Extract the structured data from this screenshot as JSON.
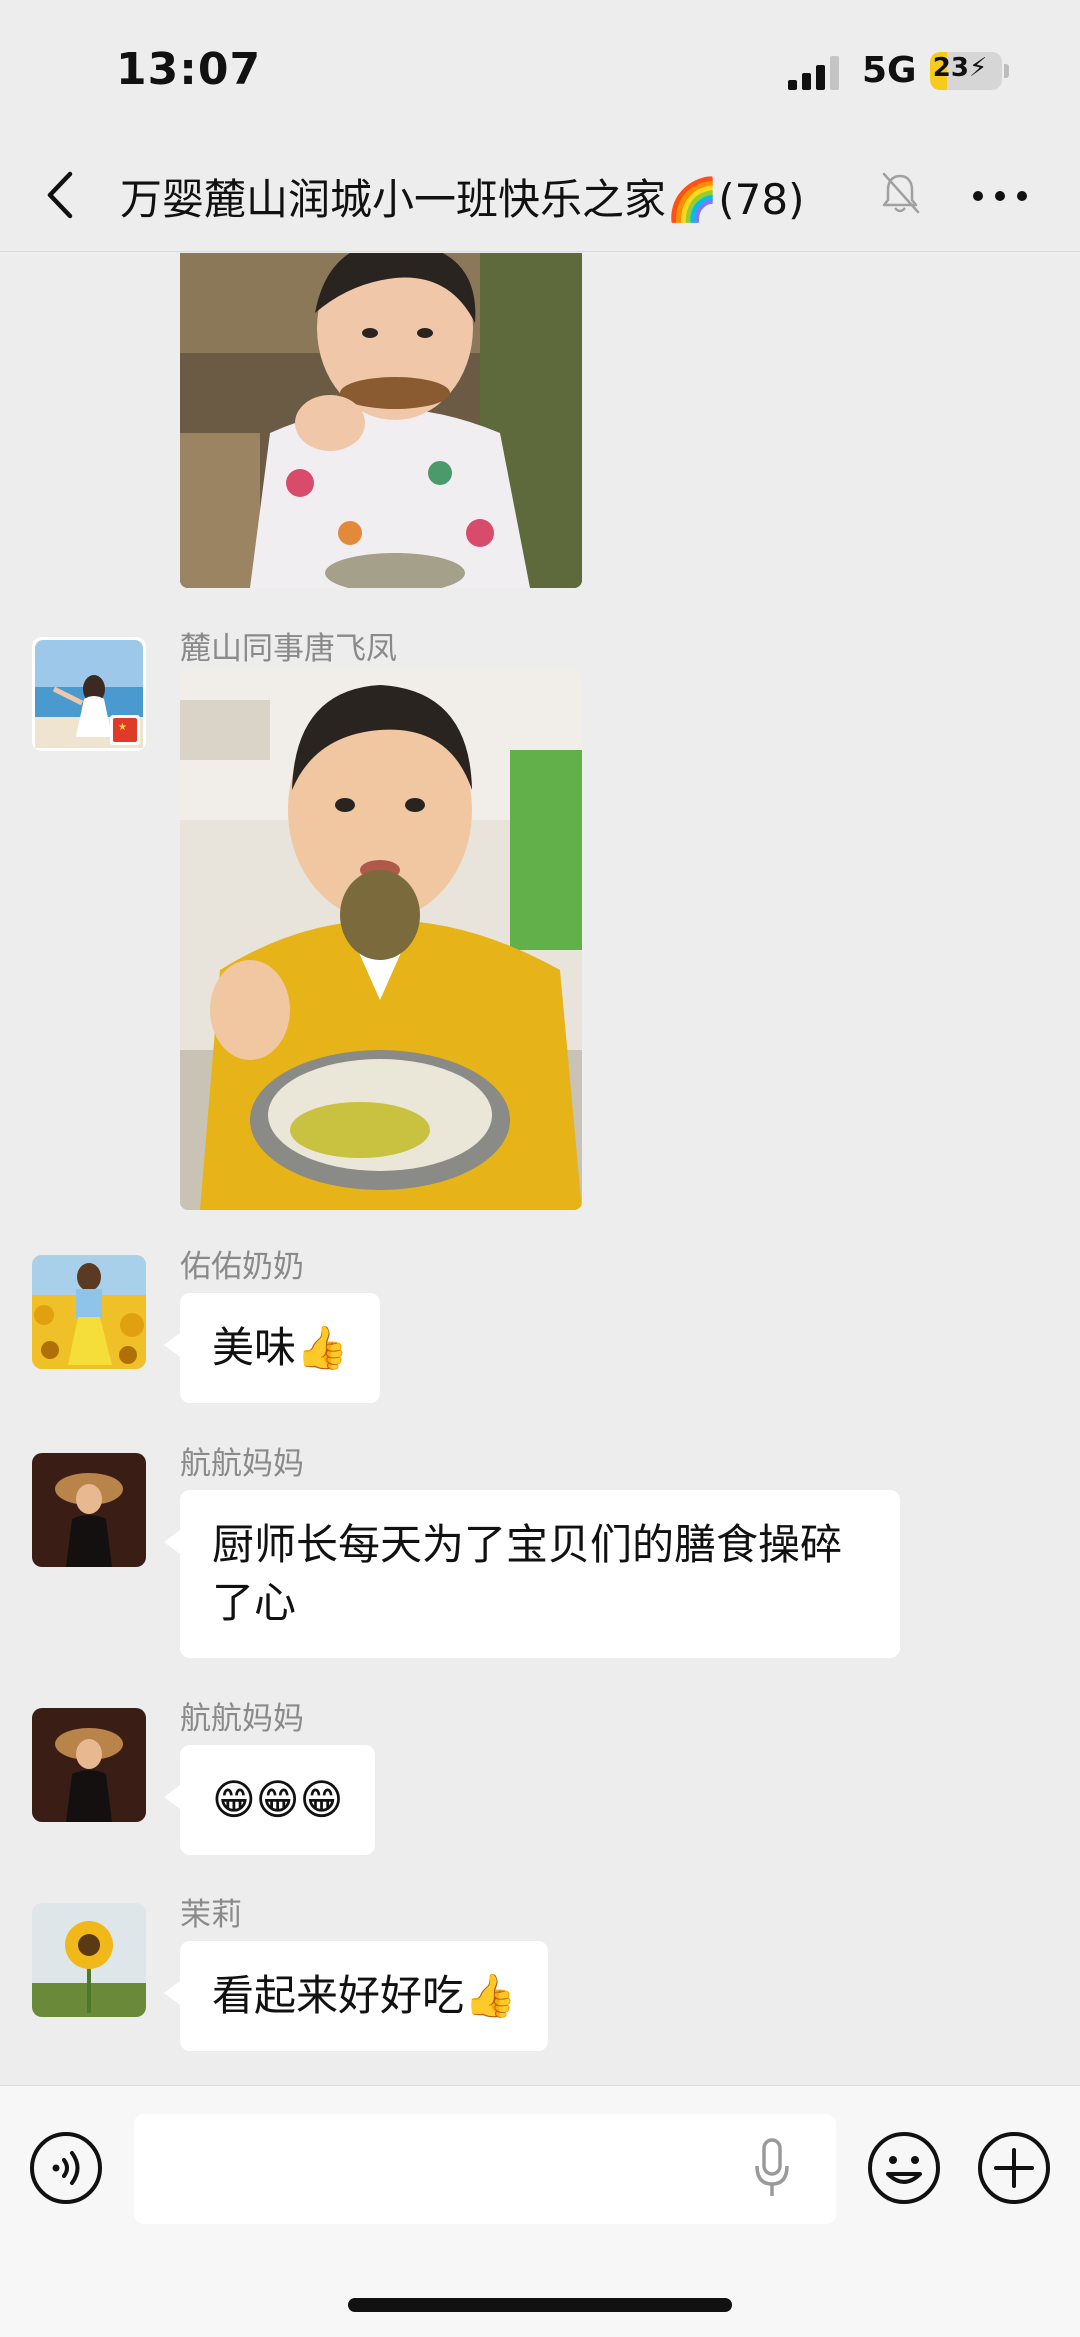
{
  "status_bar": {
    "time": "13:07",
    "network": "5G",
    "battery": "23",
    "battery_level": 0.23,
    "battery_charging": true
  },
  "nav": {
    "title": "万婴麓山润城小一班快乐之家🌈(78)",
    "muted": true
  },
  "messages": [
    {
      "type": "image",
      "sender": "",
      "content": "child-eating-photo-1"
    },
    {
      "type": "image",
      "sender": "麓山同事唐飞凤",
      "content": "child-eating-photo-2"
    },
    {
      "type": "text",
      "sender": "佑佑奶奶",
      "text": "美味👍"
    },
    {
      "type": "text",
      "sender": "航航妈妈",
      "text": "厨师长每天为了宝贝们的膳食操碎了心"
    },
    {
      "type": "text",
      "sender": "航航妈妈",
      "text": "😁😁😁"
    },
    {
      "type": "text",
      "sender": "茉莉",
      "text": "看起来好好吃👍"
    }
  ],
  "input": {
    "placeholder": ""
  },
  "colors": {
    "background": "#ededed",
    "bubble": "#ffffff",
    "sender_name": "#8a8a8a",
    "battery_fill": "#f6cb1c"
  },
  "icons": [
    "back-icon",
    "mute-bell-icon",
    "more-icon",
    "voice-icon",
    "mic-icon",
    "emoji-icon",
    "plus-icon"
  ]
}
